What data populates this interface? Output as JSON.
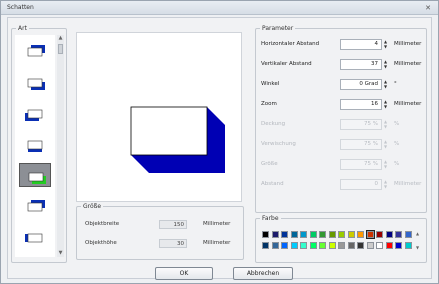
{
  "window": {
    "title": "Schatten",
    "close_glyph": "✕"
  },
  "art": {
    "title": "Art",
    "items": [
      {
        "icon": "shadow-right-top-icon"
      },
      {
        "icon": "shadow-right-bottom-icon"
      },
      {
        "icon": "shadow-left-bottom-icon"
      },
      {
        "icon": "shadow-bottom-icon"
      },
      {
        "icon": "shadow-selected-icon",
        "selected": true
      },
      {
        "icon": "shadow-top-right-icon"
      },
      {
        "icon": "shadow-left-icon"
      }
    ]
  },
  "groesse": {
    "title": "Größe",
    "rows": [
      {
        "label": "Objektbreite",
        "value": "150",
        "unit": "Millimeter"
      },
      {
        "label": "Objekthöhe",
        "value": "30",
        "unit": "Millimeter"
      }
    ]
  },
  "params": {
    "title": "Parameter",
    "rows": [
      {
        "label": "Horizontaler Abstand",
        "value": "4",
        "unit": "Millimeter",
        "disabled": false
      },
      {
        "label": "Vertikaler Abstand",
        "value": "37",
        "unit": "Millimeter",
        "disabled": false
      },
      {
        "label": "Winkel",
        "value": "0 Grad",
        "unit": "°",
        "disabled": false
      },
      {
        "label": "Zoom",
        "value": "16",
        "unit": "Millimeter",
        "disabled": false
      },
      {
        "label": "Deckung",
        "value": "75 %",
        "unit": "%",
        "disabled": true
      },
      {
        "label": "Verwischung",
        "value": "75 %",
        "unit": "%",
        "disabled": true
      },
      {
        "label": "Größe",
        "value": "75 %",
        "unit": "%",
        "disabled": true
      },
      {
        "label": "Abstand",
        "value": "0",
        "unit": "Millimeter",
        "disabled": true
      }
    ]
  },
  "farbe": {
    "title": "Farbe",
    "colors": [
      [
        "#000000",
        "#1a1a6a",
        "#003399",
        "#006699",
        "#0099cc",
        "#00cc66",
        "#339933",
        "#669900",
        "#99cc00",
        "#cccc00",
        "#ff9900",
        "#cc3300",
        "#990000",
        "#000080",
        "#333399",
        "#3366cc"
      ],
      [
        "#003366",
        "#336699",
        "#0066ff",
        "#00ccff",
        "#33ffcc",
        "#00ff66",
        "#66ff33",
        "#ccff00",
        "#999999",
        "#666666",
        "#333333",
        "#cccccc",
        "#ffffff",
        "#ff0000",
        "#0000cc",
        "#00cccc"
      ]
    ],
    "selected": "#cc3300"
  },
  "buttons": {
    "ok": "OK",
    "cancel": "Abbrechen"
  }
}
